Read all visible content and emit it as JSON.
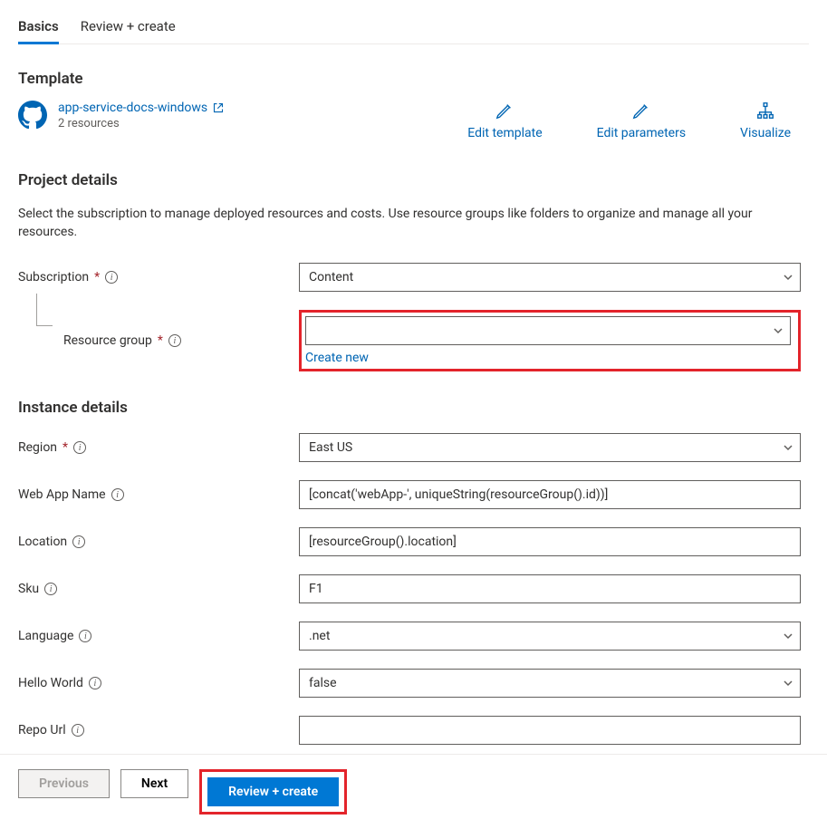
{
  "tabs": {
    "basics": "Basics",
    "review": "Review + create"
  },
  "template": {
    "title": "Template",
    "link": "app-service-docs-windows",
    "sub": "2 resources",
    "actions": {
      "edit_template": "Edit template",
      "edit_params": "Edit parameters",
      "visualize": "Visualize"
    }
  },
  "project": {
    "title": "Project details",
    "desc": "Select the subscription to manage deployed resources and costs. Use resource groups like folders to organize and manage all your resources.",
    "subscription_label": "Subscription",
    "subscription_value": "Content",
    "rg_label": "Resource group",
    "rg_value": "",
    "create_new": "Create new"
  },
  "instance": {
    "title": "Instance details",
    "region_label": "Region",
    "region_value": "East US",
    "webapp_label": "Web App Name",
    "webapp_value": "[concat('webApp-', uniqueString(resourceGroup().id))]",
    "location_label": "Location",
    "location_value": "[resourceGroup().location]",
    "sku_label": "Sku",
    "sku_value": "F1",
    "language_label": "Language",
    "language_value": ".net",
    "hello_label": "Hello World",
    "hello_value": "false",
    "repo_label": "Repo Url",
    "repo_value": ""
  },
  "footer": {
    "previous": "Previous",
    "next": "Next",
    "review": "Review + create"
  }
}
